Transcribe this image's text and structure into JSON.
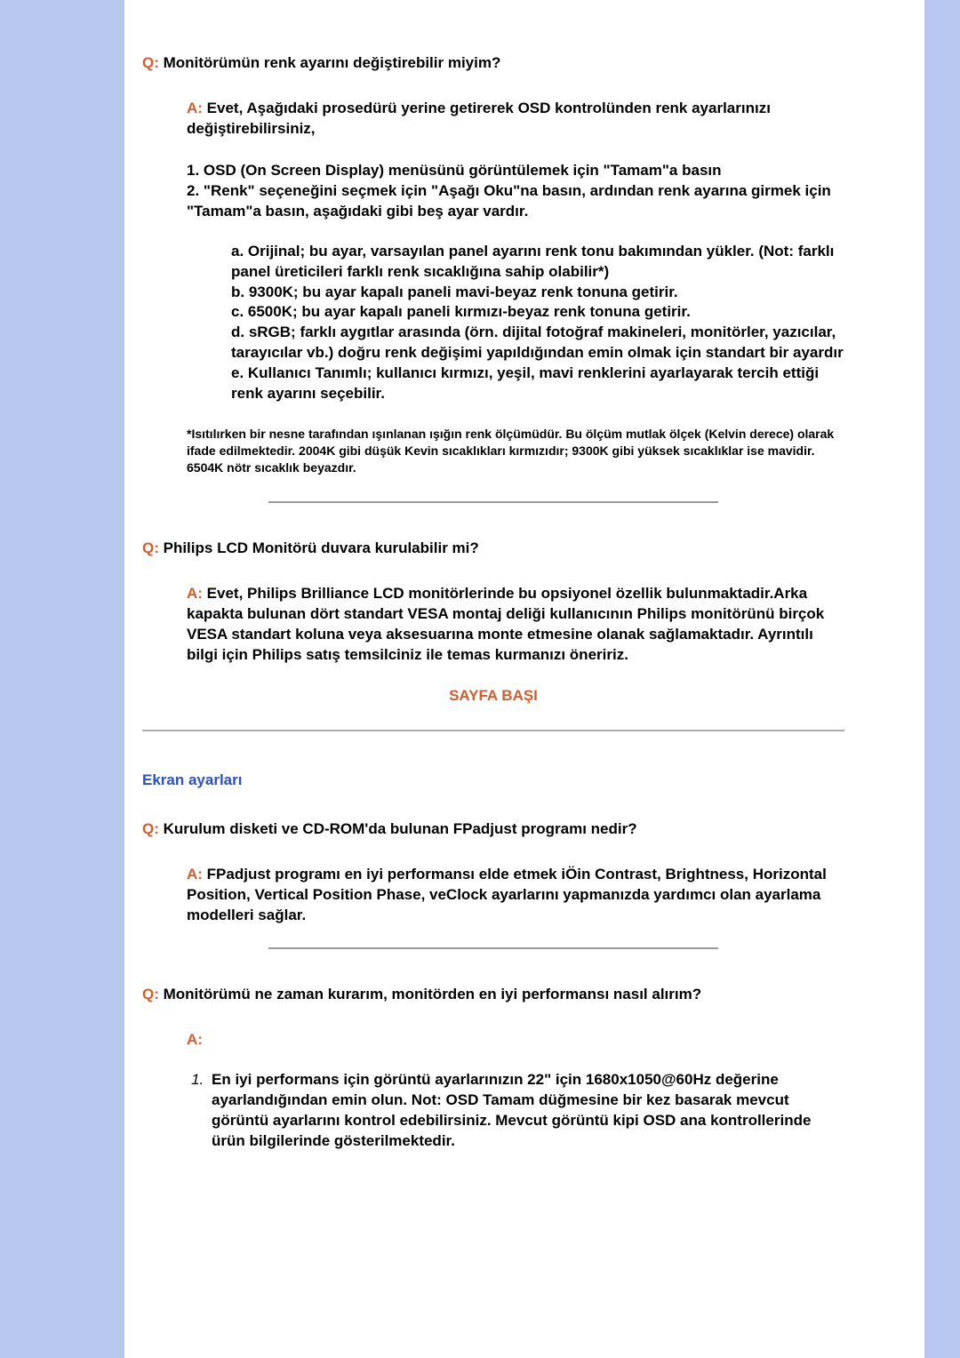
{
  "qa1": {
    "q_label": "Q:",
    "q_text": " Monitörümün renk ayarını değiştirebilir miyim?",
    "a_label": "A:",
    "a_text": " Evet, Aşağıdaki prosedürü yerine getirerek OSD kontrolünden renk ayarlarınızı değiştirebilirsiniz,",
    "steps": {
      "s1": "1. OSD (On Screen Display) menüsünü görüntülemek için \"Tamam\"a basın",
      "s2": "2. \"Renk\" seçeneğini seçmek için \"Aşağı Oku\"na basın, ardından renk ayarına girmek için \"Tamam\"a basın, aşağıdaki gibi beş ayar vardır."
    },
    "opts": {
      "a": "a. Orijinal; bu ayar, varsayılan panel ayarını renk tonu bakımından yükler. (Not: farklı panel üreticileri farklı renk sıcaklığına sahip olabilir*)",
      "b": "b. 9300K; bu ayar kapalı paneli mavi-beyaz renk tonuna getirir.",
      "c": "c. 6500K; bu ayar kapalı paneli kırmızı-beyaz renk tonuna getirir.",
      "d": "d. sRGB; farklı aygıtlar arasında (örn. dijital fotoğraf makineleri, monitörler, yazıcılar, tarayıcılar vb.) doğru renk değişimi yapıldığından emin olmak için standart bir ayardır",
      "e": "e. Kullanıcı Tanımlı; kullanıcı kırmızı, yeşil, mavi renklerini ayarlayarak tercih ettiği renk ayarını seçebilir."
    },
    "footnote": "*Isıtılırken bir nesne tarafından ışınlanan ışığın renk ölçümüdür. Bu ölçüm mutlak ölçek (Kelvin derece) olarak ifade edilmektedir. 2004K gibi düşük Kevin sıcaklıkları kırmızıdır; 9300K gibi yüksek sıcaklıklar ise mavidir. 6504K nötr sıcaklık beyazdır."
  },
  "qa2": {
    "q_label": "Q:",
    "q_text": " Philips LCD Monitörü duvara kurulabilir mi?",
    "a_label": "A:",
    "a_text": " Evet, Philips Brilliance LCD monitörlerinde bu opsiyonel özellik bulunmaktadir.Arka kapakta bulunan dört standart VESA montaj deliği kullanıcının Philips monitörünü birçok VESA standart koluna veya aksesuarına monte etmesine olanak sağlamaktadır. Ayrıntılı bilgi için Philips satış temsilciniz ile temas kurmanızı öneririz."
  },
  "back_to_top": "SAYFA BAŞI",
  "section2": {
    "title": "Ekran ayarları"
  },
  "qa3": {
    "q_label": "Q:",
    "q_text": " Kurulum disketi ve CD-ROM'da bulunan FPadjust programı nedir?",
    "a_label": "A:",
    "a_text": " FPadjust programı en iyi performansı elde etmek iÖin Contrast, Brightness, Horizontal Position, Vertical Position Phase, veClock ayarlarını yapmanızda yardımcı olan ayarlama modelleri sağlar."
  },
  "qa4": {
    "q_label": "Q:",
    "q_text": " Monitörümü ne zaman kurarım, monitörden en iyi performansı nasıl alırım?",
    "a_label": "A:",
    "li1": "En iyi performans için görüntü ayarlarınızın 22\" için 1680x1050@60Hz değerine ayarlandığından emin olun. Not: OSD Tamam düğmesine bir kez basarak mevcut görüntü ayarlarını kontrol edebilirsiniz. Mevcut görüntü kipi OSD ana kontrollerinde ürün bilgilerinde gösterilmektedir."
  }
}
